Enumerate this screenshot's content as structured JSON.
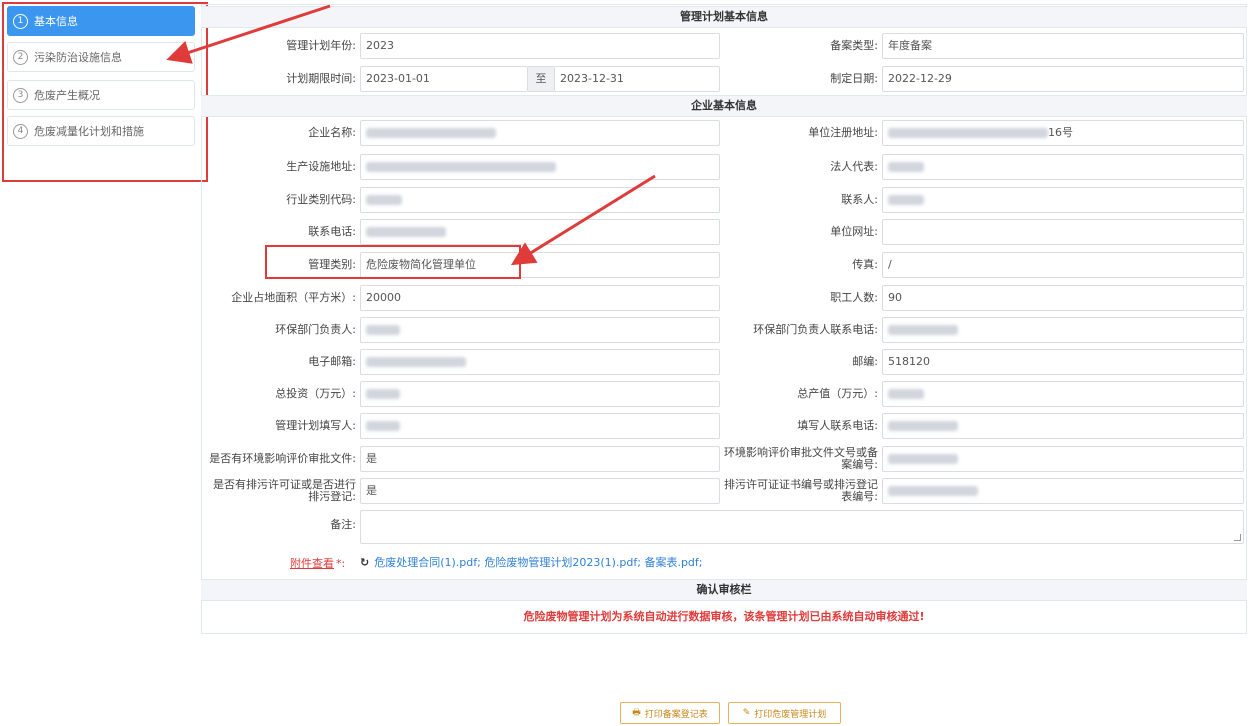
{
  "steps": [
    {
      "num": "1",
      "label": "基本信息"
    },
    {
      "num": "2",
      "label": "污染防治设施信息"
    },
    {
      "num": "3",
      "label": "危废产生概况"
    },
    {
      "num": "4",
      "label": "危废减量化计划和措施"
    }
  ],
  "sections": {
    "plan": "管理计划基本信息",
    "company": "企业基本信息",
    "confirm": "确认审核栏"
  },
  "plan": {
    "year_label": "管理计划年份:",
    "year": "2023",
    "type_label": "备案类型:",
    "type": "年度备案",
    "period_label": "计划期限时间:",
    "start": "2023-01-01",
    "to": "至",
    "end": "2023-12-31",
    "made_label": "制定日期:",
    "made": "2022-12-29"
  },
  "company": {
    "name_label": "企业名称:",
    "reg_addr_label": "单位注册地址:",
    "reg_addr_suffix": "16号",
    "prod_addr_label": "生产设施地址:",
    "legal_label": "法人代表:",
    "industry_label": "行业类别代码:",
    "contact_label": "联系人:",
    "phone_label": "联系电话:",
    "website_label": "单位网址:",
    "mgmt_type_label": "管理类别:",
    "mgmt_type": "危险废物简化管理单位",
    "fax_label": "传真:",
    "fax": "/",
    "area_label": "企业占地面积（平方米）:",
    "area": "20000",
    "staff_label": "职工人数:",
    "staff": "90",
    "env_head_label": "环保部门负责人:",
    "env_head_phone_label": "环保部门负责人联系电话:",
    "email_label": "电子邮箱:",
    "zip_label": "邮编:",
    "zip": "518120",
    "invest_label": "总投资（万元）:",
    "output_label": "总产值（万元）:",
    "filler_label": "管理计划填写人:",
    "filler_phone_label": "填写人联系电话:",
    "eia_label": "是否有环境影响评价审批文件:",
    "eia": "是",
    "eia_no_label": "环境影响评价审批文件文号或备案编号:",
    "permit_label": "是否有排污许可证或是否进行排污登记:",
    "permit": "是",
    "permit_no_label": "排污许可证证书编号或排污登记表编号:",
    "remark_label": "备注:"
  },
  "attachments": {
    "label": "附件查看",
    "req": "*:",
    "files": "危废处理合同(1).pdf;  危险废物管理计划2023(1).pdf;  备案表.pdf;"
  },
  "notice": "危险废物管理计划为系统自动进行数据审核，该条管理计划已由系统自动审核通过!",
  "buttons": {
    "print_record": "打印备案登记表",
    "print_plan": "打印危废管理计划"
  },
  "colors": {
    "accent": "#3a96ee",
    "annotation": "#e03b3b",
    "button": "#c8871c"
  }
}
